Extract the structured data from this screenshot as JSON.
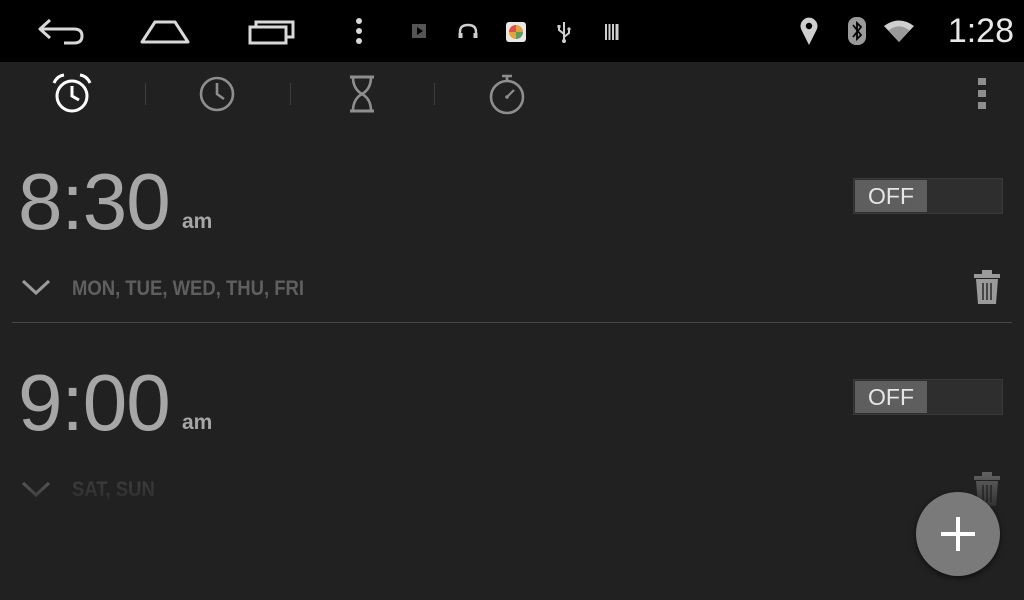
{
  "status_bar": {
    "time": "1:28",
    "nav_icons": [
      "back-icon",
      "home-icon",
      "recents-icon",
      "menu-dots-icon"
    ],
    "notification_icons": [
      "play-icon",
      "headphones-icon",
      "app-notification-icon",
      "usb-icon",
      "barcode-icon"
    ],
    "system_icons": [
      "location-icon",
      "bluetooth-icon",
      "wifi-icon"
    ]
  },
  "tabs": [
    {
      "icon": "alarm-icon",
      "selected": true
    },
    {
      "icon": "clock-icon",
      "selected": false
    },
    {
      "icon": "timer-icon",
      "selected": false
    },
    {
      "icon": "stopwatch-icon",
      "selected": false
    }
  ],
  "alarms": [
    {
      "time": "8:30",
      "ampm": "am",
      "toggle": "OFF",
      "days": "MON, TUE, WED, THU, FRI"
    },
    {
      "time": "9:00",
      "ampm": "am",
      "toggle": "OFF",
      "days": "SAT, SUN"
    }
  ],
  "colors": {
    "background": "#212121",
    "status_bar": "#000000",
    "fab": "#7a7a7a",
    "text": "#a6a6a6"
  }
}
